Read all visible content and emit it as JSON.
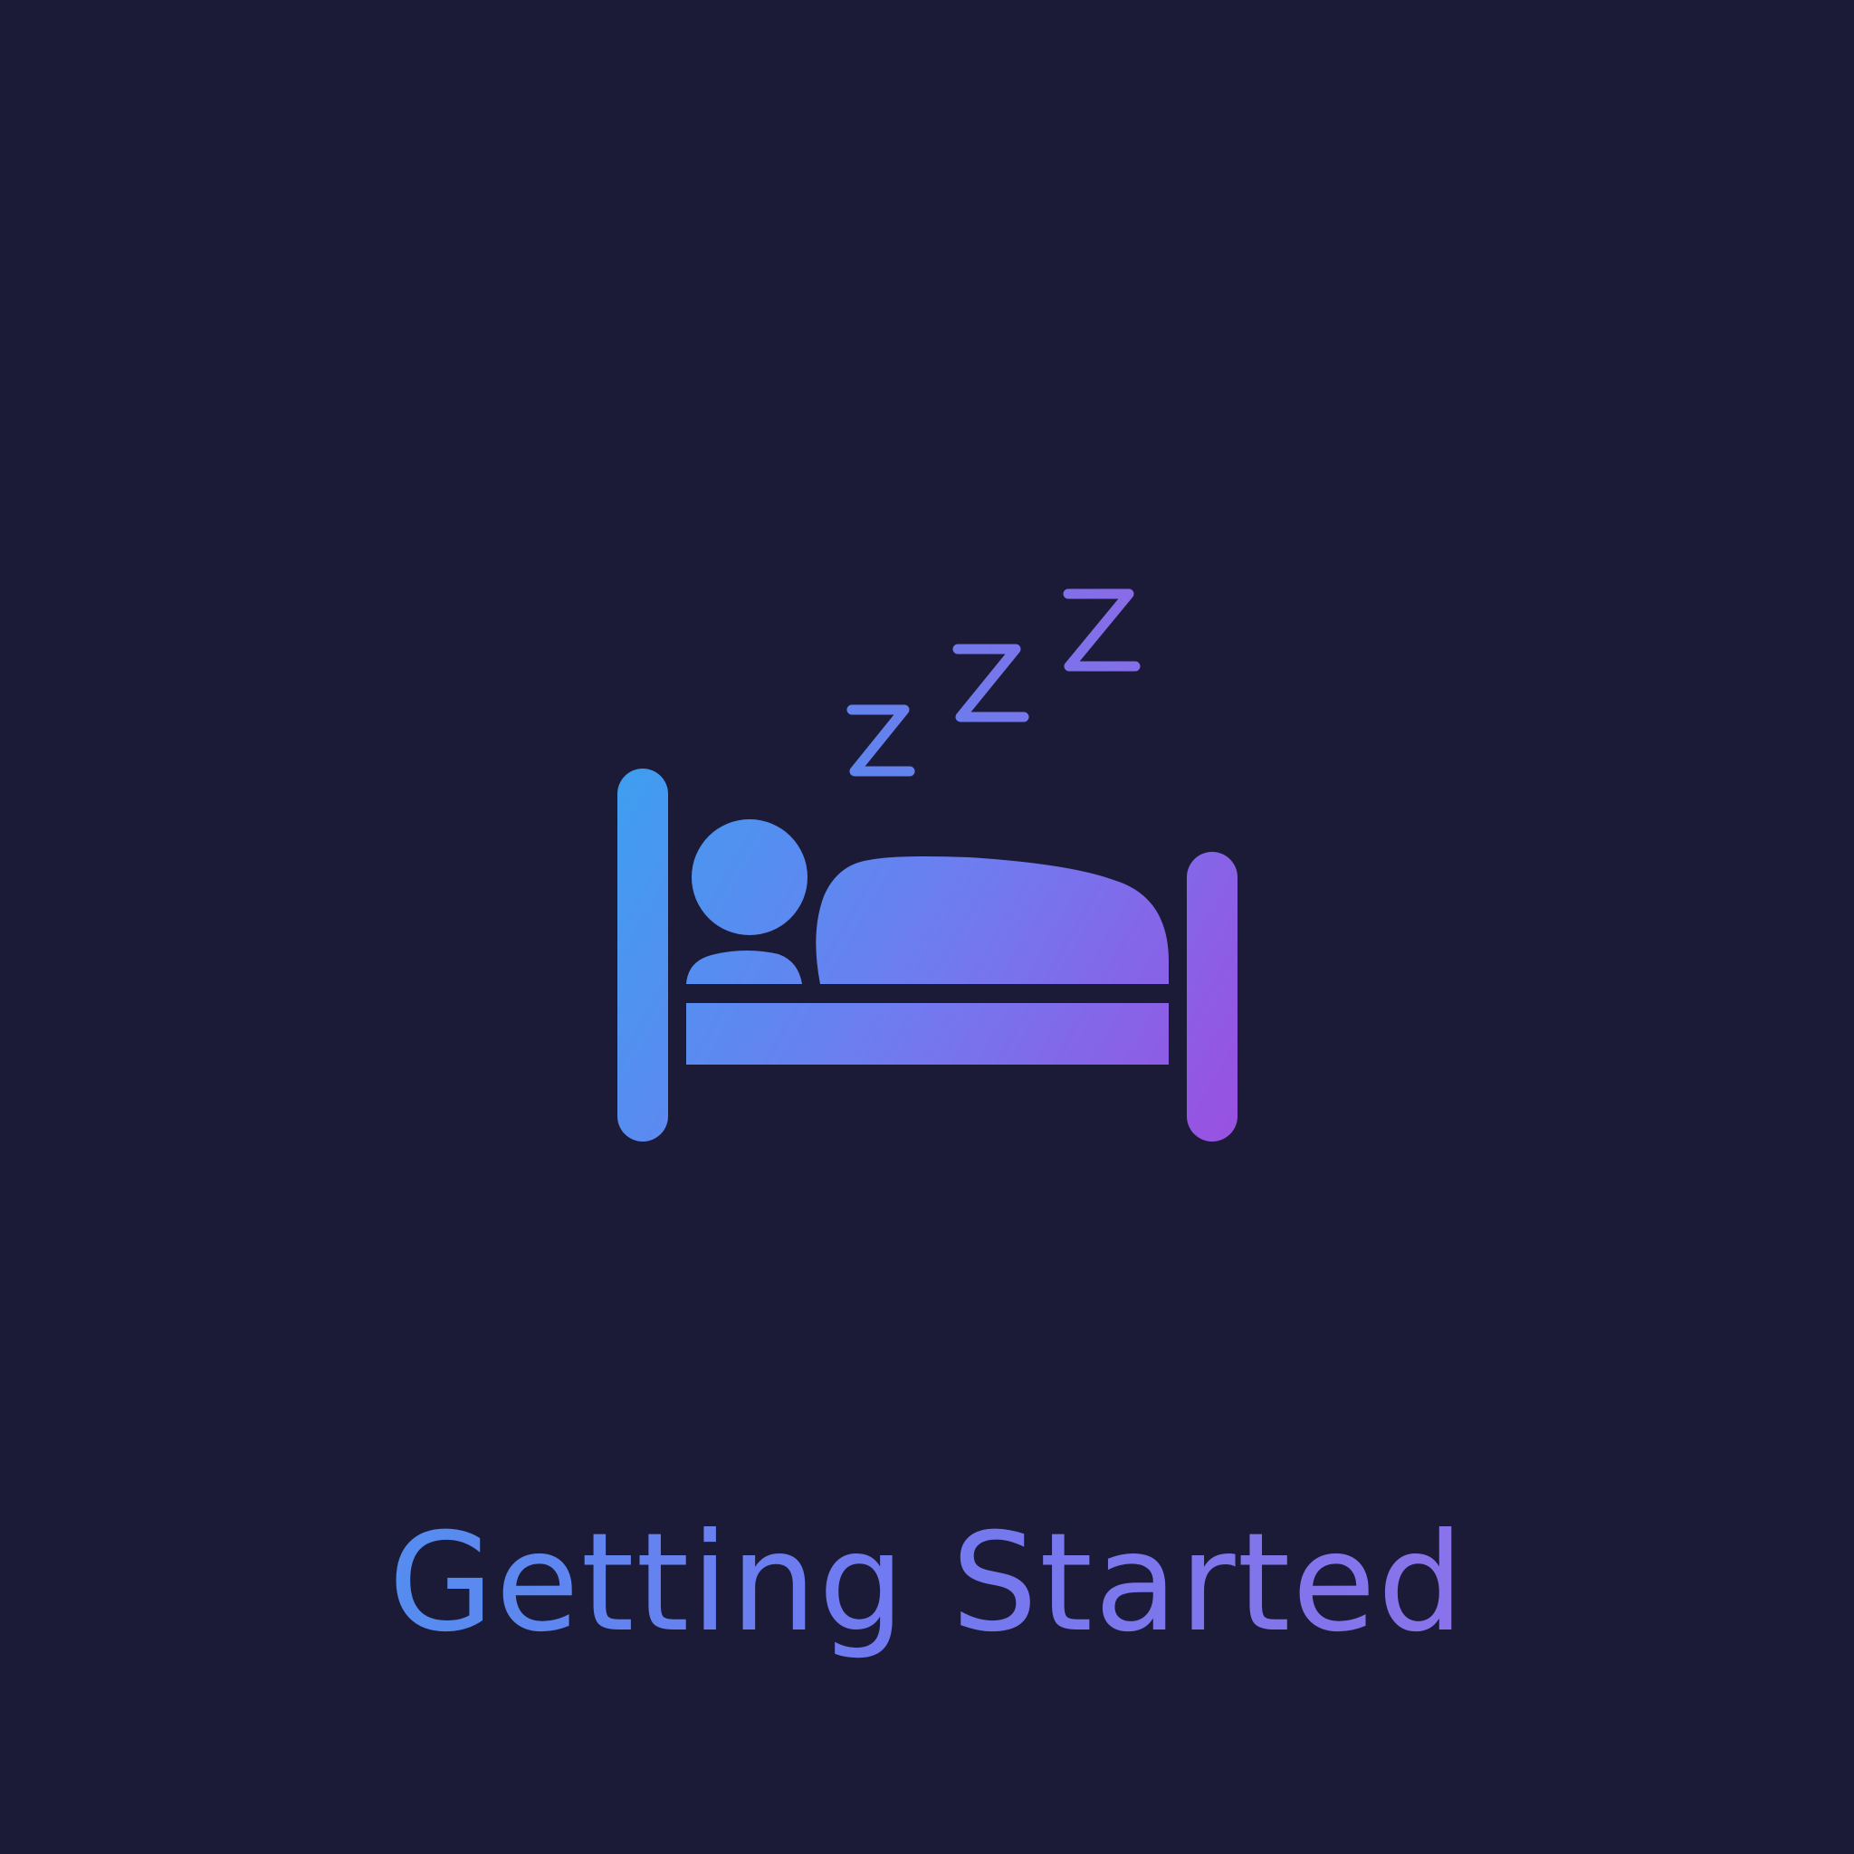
{
  "screen": {
    "title": "Getting Started",
    "illustration_icon": "sleeping-in-bed-icon",
    "zzz_icon": "zzz-icon"
  },
  "colors": {
    "background": "#1b1b38",
    "gradient_start": "#3e9df0",
    "gradient_mid": "#6f7bf0",
    "gradient_end": "#9a50e0"
  }
}
